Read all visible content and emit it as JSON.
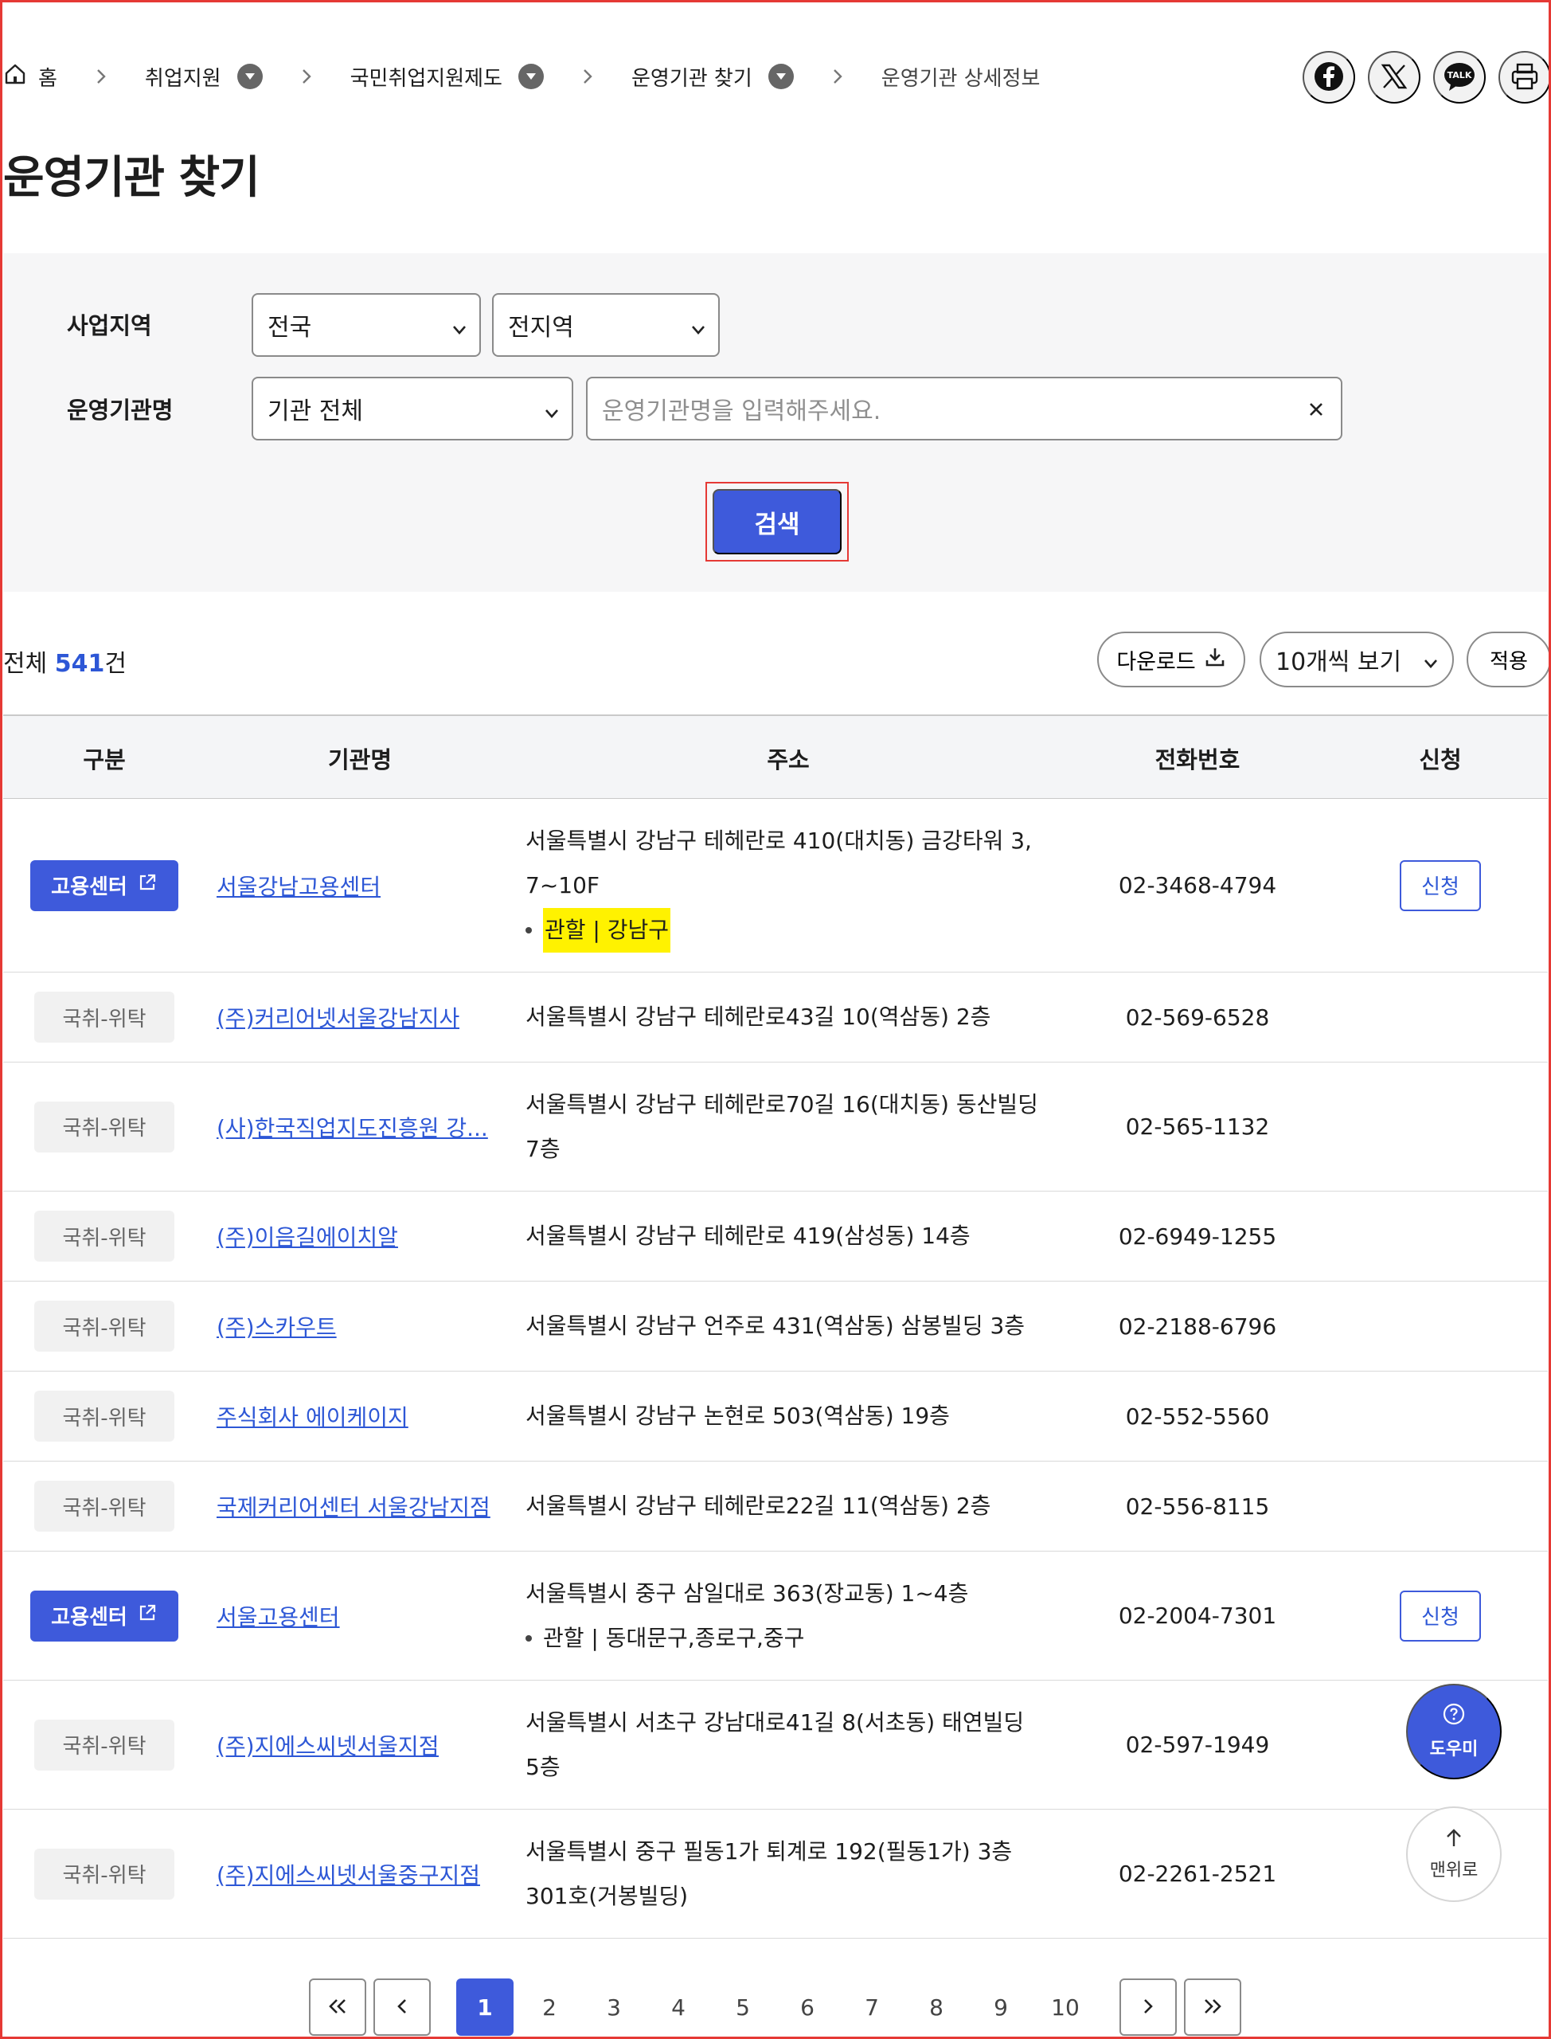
{
  "breadcrumb": {
    "home": "홈",
    "items": [
      "취업지원",
      "국민취업지원제도",
      "운영기관 찾기"
    ],
    "current": "운영기관 상세정보"
  },
  "share": {
    "facebook": "facebook-icon",
    "x": "x-icon",
    "kakao": "kakaotalk-icon",
    "kakao_text": "TALK",
    "print": "print-icon"
  },
  "page_title": "운영기관 찾기",
  "search": {
    "region_label": "사업지역",
    "region_value": "전국",
    "subregion_value": "전지역",
    "org_label": "운영기관명",
    "org_type_value": "기관 전체",
    "org_placeholder": "운영기관명을 입력해주세요.",
    "button": "검색"
  },
  "summary": {
    "prefix": "전체 ",
    "count": "541",
    "suffix": "건",
    "download": "다운로드",
    "view_option": "10개씩 보기",
    "apply": "적용"
  },
  "table": {
    "headers": [
      "구분",
      "기관명",
      "주소",
      "전화번호",
      "신청"
    ],
    "rows": [
      {
        "type": "고용센터",
        "name": "서울강남고용센터",
        "addr1": "서울특별시 강남구 테헤란로 410(대치동) 금강타워 3,",
        "addr2": "7~10F",
        "juris": "관할 | 강남구",
        "tel": "02-3468-4794",
        "apply": "신청"
      },
      {
        "type": "국취-위탁",
        "name": "(주)커리어넷서울강남지사",
        "addr1": "서울특별시 강남구 테헤란로43길 10(역삼동) 2층",
        "tel": "02-569-6528"
      },
      {
        "type": "국취-위탁",
        "name": "(사)한국직업지도진흥원 강...",
        "addr1": "서울특별시 강남구 테헤란로70길 16(대치동) 동산빌딩",
        "addr2": "7층",
        "tel": "02-565-1132"
      },
      {
        "type": "국취-위탁",
        "name": "(주)이음길에이치알",
        "addr1": "서울특별시 강남구 테헤란로 419(삼성동) 14층",
        "tel": "02-6949-1255"
      },
      {
        "type": "국취-위탁",
        "name": "(주)스카우트",
        "addr1": "서울특별시 강남구 언주로 431(역삼동) 삼봉빌딩 3층",
        "tel": "02-2188-6796"
      },
      {
        "type": "국취-위탁",
        "name": "주식회사 에이케이지",
        "addr1": "서울특별시 강남구 논현로 503(역삼동) 19층",
        "tel": "02-552-5560"
      },
      {
        "type": "국취-위탁",
        "name": "국제커리어센터 서울강남지점",
        "addr1": "서울특별시 강남구 테헤란로22길 11(역삼동) 2층",
        "tel": "02-556-8115"
      },
      {
        "type": "고용센터",
        "name": "서울고용센터",
        "addr1": "서울특별시 중구 삼일대로 363(장교동) 1~4층",
        "juris": "관할 | 동대문구,종로구,중구",
        "tel": "02-2004-7301",
        "apply": "신청"
      },
      {
        "type": "국취-위탁",
        "name": "(주)지에스씨넷서울지점",
        "addr1": "서울특별시 서초구 강남대로41길 8(서초동) 태연빌딩",
        "addr2": "5층",
        "tel": "02-597-1949"
      },
      {
        "type": "국취-위탁",
        "name": "(주)지에스씨넷서울중구지점",
        "addr1": "서울특별시 중구 필동1가 퇴계로 192(필동1가) 3층",
        "addr2": "301호(거봉빌딩)",
        "tel": "02-2261-2521"
      }
    ]
  },
  "floating": {
    "help": "도우미",
    "top": "맨위로"
  },
  "pagination": {
    "current": 1,
    "pages": [
      "1",
      "2",
      "3",
      "4",
      "5",
      "6",
      "7",
      "8",
      "9",
      "10"
    ]
  },
  "colors": {
    "primary": "#3e5adb",
    "link": "#2d57d6",
    "highlight": "#fff200",
    "focus_outline": "#e53935"
  }
}
